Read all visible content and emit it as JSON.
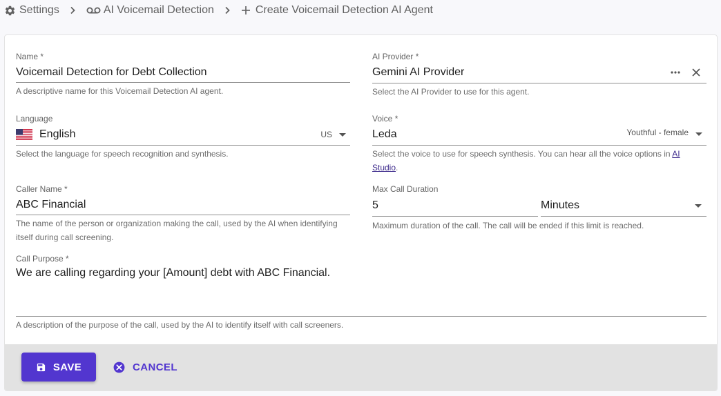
{
  "breadcrumb": {
    "items": [
      {
        "label": "Settings",
        "icon": "gear-icon"
      },
      {
        "label": "AI Voicemail Detection",
        "icon": "voicemail-icon"
      },
      {
        "label": "Create Voicemail Detection AI Agent",
        "icon": "plus-icon"
      }
    ]
  },
  "form": {
    "name": {
      "label": "Name *",
      "value": "Voicemail Detection for Debt Collection",
      "help": "A descriptive name for this Voicemail Detection AI agent."
    },
    "ai_provider": {
      "label": "AI Provider *",
      "value": "Gemini AI Provider",
      "help": "Select the AI Provider to use for this agent."
    },
    "language": {
      "label": "Language",
      "value": "English",
      "region": "US",
      "flag": "us-flag-icon",
      "help": "Select the language for speech recognition and synthesis."
    },
    "voice": {
      "label": "Voice *",
      "value": "Leda",
      "style": "Youthful - female",
      "help_prefix": "Select the voice to use for speech synthesis. You can hear all the voice options in ",
      "help_link": "AI Studio",
      "help_suffix": "."
    },
    "caller_name": {
      "label": "Caller Name *",
      "value": "ABC Financial",
      "help": "The name of the person or organization making the call, used by the AI when identifying itself during call screening."
    },
    "max_call_duration": {
      "label": "Max Call Duration",
      "value": "5",
      "unit": "Minutes",
      "help": "Maximum duration of the call. The call will be ended if this limit is reached."
    },
    "call_purpose": {
      "label": "Call Purpose *",
      "value": "We are calling regarding your [Amount] debt with ABC Financial.",
      "help": "A description of the purpose of the call, used by the AI to identify itself with call screeners."
    }
  },
  "actions": {
    "save_label": "SAVE",
    "cancel_label": "CANCEL"
  },
  "colors": {
    "primary": "#5236cf",
    "footer_bg": "#e2e2e2",
    "link": "#3d2a8c"
  }
}
